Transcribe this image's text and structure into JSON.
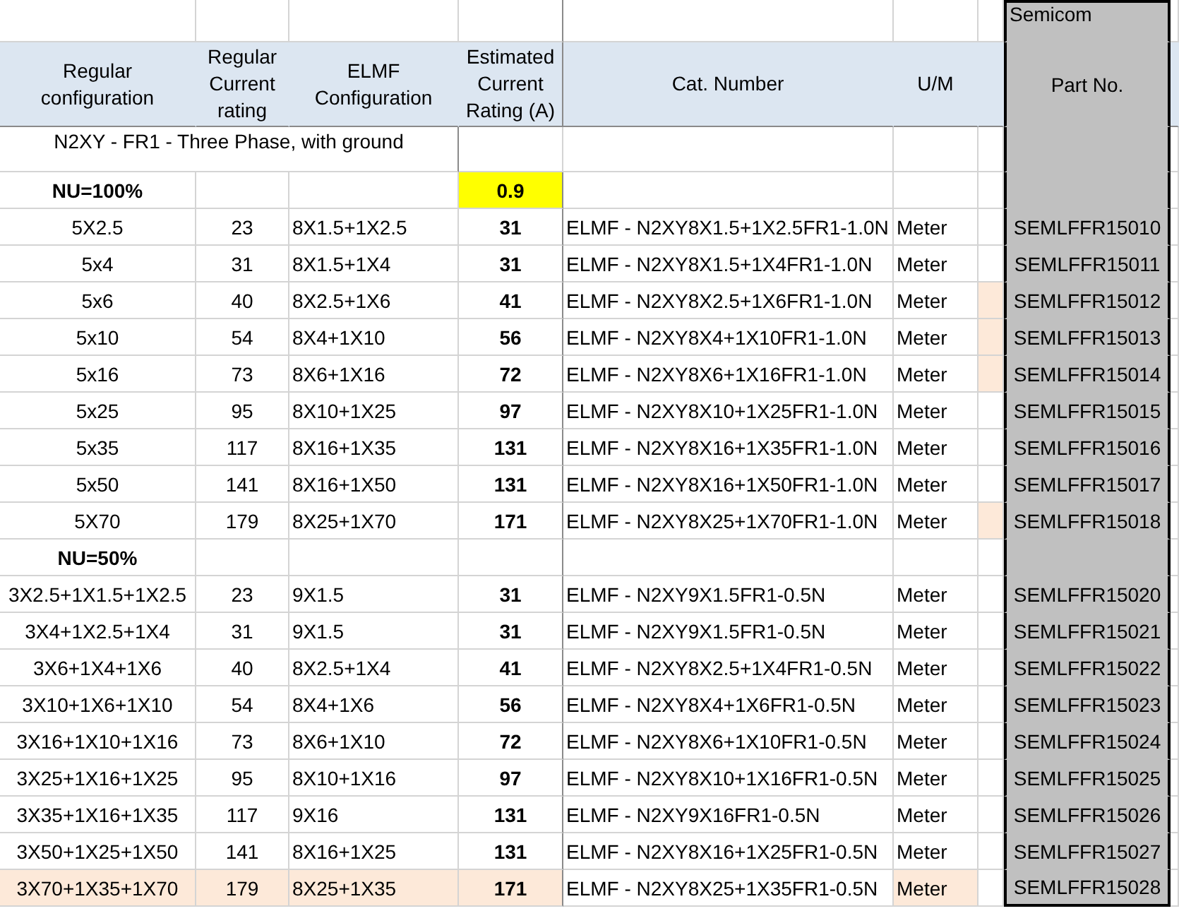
{
  "corner_note": "Semicom",
  "headers": [
    "Regular configuration",
    "Regular Current rating",
    "ELMF Configuration",
    "Estimated Current Rating (A)",
    "Cat. Number",
    "U/M",
    "Part No."
  ],
  "title": "N2XY - FR1 - Three Phase, with ground",
  "sections": [
    {
      "group": "NU=100%",
      "factor": "0.9",
      "rows": [
        {
          "regular": "5X2.5",
          "rating": "23",
          "elmf": "8X1.5+1X2.5",
          "estimated": "31",
          "cat": "ELMF - N2XY8X1.5+1X2.5FR1-1.0N",
          "um": "Meter",
          "part": "SEMLFFR15010",
          "flagged": false,
          "highlighted": false
        },
        {
          "regular": "5x4",
          "rating": "31",
          "elmf": "8X1.5+1X4",
          "estimated": "31",
          "cat": "ELMF - N2XY8X1.5+1X4FR1-1.0N",
          "um": "Meter",
          "part": "SEMLFFR15011",
          "flagged": false,
          "highlighted": false
        },
        {
          "regular": "5x6",
          "rating": "40",
          "elmf": "8X2.5+1X6",
          "estimated": "41",
          "cat": "ELMF - N2XY8X2.5+1X6FR1-1.0N",
          "um": "Meter",
          "part": "SEMLFFR15012",
          "flagged": true,
          "highlighted": false
        },
        {
          "regular": "5x10",
          "rating": "54",
          "elmf": "8X4+1X10",
          "estimated": "56",
          "cat": "ELMF - N2XY8X4+1X10FR1-1.0N",
          "um": "Meter",
          "part": "SEMLFFR15013",
          "flagged": true,
          "highlighted": false
        },
        {
          "regular": "5x16",
          "rating": "73",
          "elmf": "8X6+1X16",
          "estimated": "72",
          "cat": "ELMF - N2XY8X6+1X16FR1-1.0N",
          "um": "Meter",
          "part": "SEMLFFR15014",
          "flagged": true,
          "highlighted": false
        },
        {
          "regular": "5x25",
          "rating": "95",
          "elmf": "8X10+1X25",
          "estimated": "97",
          "cat": "ELMF - N2XY8X10+1X25FR1-1.0N",
          "um": "Meter",
          "part": "SEMLFFR15015",
          "flagged": false,
          "highlighted": false
        },
        {
          "regular": "5x35",
          "rating": "117",
          "elmf": "8X16+1X35",
          "estimated": "131",
          "cat": "ELMF - N2XY8X16+1X35FR1-1.0N",
          "um": "Meter",
          "part": "SEMLFFR15016",
          "flagged": false,
          "highlighted": false
        },
        {
          "regular": "5x50",
          "rating": "141",
          "elmf": "8X16+1X50",
          "estimated": "131",
          "cat": "ELMF - N2XY8X16+1X50FR1-1.0N",
          "um": "Meter",
          "part": "SEMLFFR15017",
          "flagged": false,
          "highlighted": false
        },
        {
          "regular": "5X70",
          "rating": "179",
          "elmf": "8X25+1X70",
          "estimated": "171",
          "cat": "ELMF - N2XY8X25+1X70FR1-1.0N",
          "um": "Meter",
          "part": "SEMLFFR15018",
          "flagged": true,
          "highlighted": false
        }
      ]
    },
    {
      "group": "NU=50%",
      "rows": [
        {
          "regular": "3X2.5+1X1.5+1X2.5",
          "rating": "23",
          "elmf": "9X1.5",
          "estimated": "31",
          "cat": "ELMF - N2XY9X1.5FR1-0.5N",
          "um": "Meter",
          "part": "SEMLFFR15020",
          "flagged": false,
          "highlighted": false
        },
        {
          "regular": "3X4+1X2.5+1X4",
          "rating": "31",
          "elmf": "9X1.5",
          "estimated": "31",
          "cat": "ELMF - N2XY9X1.5FR1-0.5N",
          "um": "Meter",
          "part": "SEMLFFR15021",
          "flagged": false,
          "highlighted": false
        },
        {
          "regular": "3X6+1X4+1X6",
          "rating": "40",
          "elmf": "8X2.5+1X4",
          "estimated": "41",
          "cat": "ELMF - N2XY8X2.5+1X4FR1-0.5N",
          "um": "Meter",
          "part": "SEMLFFR15022",
          "flagged": false,
          "highlighted": false
        },
        {
          "regular": "3X10+1X6+1X10",
          "rating": "54",
          "elmf": "8X4+1X6",
          "estimated": "56",
          "cat": "ELMF - N2XY8X4+1X6FR1-0.5N",
          "um": "Meter",
          "part": "SEMLFFR15023",
          "flagged": false,
          "highlighted": false
        },
        {
          "regular": "3X16+1X10+1X16",
          "rating": "73",
          "elmf": "8X6+1X10",
          "estimated": "72",
          "cat": "ELMF - N2XY8X6+1X10FR1-0.5N",
          "um": "Meter",
          "part": "SEMLFFR15024",
          "flagged": false,
          "highlighted": false
        },
        {
          "regular": "3X25+1X16+1X25",
          "rating": "95",
          "elmf": "8X10+1X16",
          "estimated": "97",
          "cat": "ELMF - N2XY8X10+1X16FR1-0.5N",
          "um": "Meter",
          "part": "SEMLFFR15025",
          "flagged": false,
          "highlighted": false
        },
        {
          "regular": "3X35+1X16+1X35",
          "rating": "117",
          "elmf": "9X16",
          "estimated": "131",
          "cat": "ELMF - N2XY9X16FR1-0.5N",
          "um": "Meter",
          "part": "SEMLFFR15026",
          "flagged": false,
          "highlighted": false
        },
        {
          "regular": "3X50+1X25+1X50",
          "rating": "141",
          "elmf": "8X16+1X25",
          "estimated": "131",
          "cat": "ELMF - N2XY8X16+1X25FR1-0.5N",
          "um": "Meter",
          "part": "SEMLFFR15027",
          "flagged": false,
          "highlighted": false
        },
        {
          "regular": "3X70+1X35+1X70",
          "rating": "179",
          "elmf": "8X25+1X35",
          "estimated": "171",
          "cat": "ELMF - N2XY8X25+1X35FR1-0.5N",
          "um": "Meter",
          "part": "SEMLFFR15028",
          "flagged": false,
          "highlighted": true
        }
      ]
    }
  ]
}
